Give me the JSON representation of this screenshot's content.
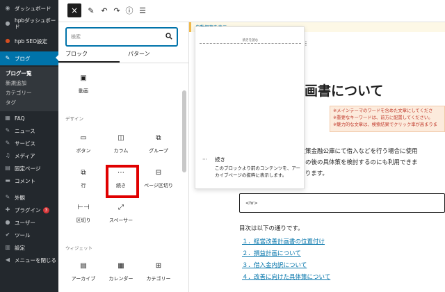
{
  "admin_menu": {
    "top_items": [
      {
        "icon": "dashboard-icon",
        "label": "ダッシュボード"
      },
      {
        "icon": "hpb-icon",
        "label": "hpbダッシュボード"
      },
      {
        "icon": "seo-icon",
        "label": "hpb SEO設定"
      }
    ],
    "active_item": {
      "icon": "blog-pin-icon",
      "label": "ブログ"
    },
    "submenu": [
      "ブログ一覧",
      "新規追加",
      "カテゴリー",
      "タグ"
    ],
    "items": [
      {
        "icon": "faq-icon",
        "label": "FAQ"
      },
      {
        "icon": "news-icon",
        "label": "ニュース"
      },
      {
        "icon": "service-icon",
        "label": "サービス"
      },
      {
        "icon": "media-icon",
        "label": "メディア"
      },
      {
        "icon": "page-icon",
        "label": "固定ページ"
      },
      {
        "icon": "comment-icon",
        "label": "コメント"
      },
      {
        "icon": "appearance-icon",
        "label": "外観"
      },
      {
        "icon": "plugin-icon",
        "label": "プラグイン",
        "badge": "3"
      },
      {
        "icon": "user-icon",
        "label": "ユーザー"
      },
      {
        "icon": "tool-icon",
        "label": "ツール"
      },
      {
        "icon": "settings-icon",
        "label": "設定"
      },
      {
        "icon": "collapse-icon",
        "label": "メニューを閉じる"
      }
    ]
  },
  "toolbar": {
    "close": "×",
    "tools": "✎",
    "undo": "↶",
    "redo": "↷",
    "info": "ⓘ",
    "outline": "☰"
  },
  "inserter": {
    "search_placeholder": "検索",
    "tabs": [
      "ブロック",
      "パターン"
    ],
    "media_block": {
      "icon": "video-icon",
      "label": "動画"
    },
    "design_heading": "デザイン",
    "design_blocks": [
      {
        "icon": "buttons-icon",
        "label": "ボタン"
      },
      {
        "icon": "columns-icon",
        "label": "カラム"
      },
      {
        "icon": "group-icon",
        "label": "グループ"
      },
      {
        "icon": "row-icon",
        "label": "行"
      },
      {
        "icon": "more-icon",
        "label": "続き"
      },
      {
        "icon": "page-break-icon",
        "label": "ページ区切り"
      },
      {
        "icon": "separator-icon",
        "label": "区切り"
      },
      {
        "icon": "spacer-icon",
        "label": "スペーサー"
      }
    ],
    "widgets_heading": "ウィジェット",
    "widget_blocks": [
      {
        "icon": "archive-icon",
        "label": "アーカイブ"
      },
      {
        "icon": "calendar-icon",
        "label": "カレンダー"
      },
      {
        "icon": "categories-icon",
        "label": "カテゴリー"
      }
    ]
  },
  "preview": {
    "inner_label": "続きを読む",
    "block_title": "続き",
    "description": "このブロックより前のコンテンツを、アーカイブページの抜粋に表示します。"
  },
  "editor": {
    "autosave_link": "自動保存を表示",
    "title": "画書について",
    "notes": [
      "※メインテーマのワードを含めた文章にしてくださ",
      "※重要なキーワードは、前方に配置してください。",
      "※魅力的な文章は、検索結果でクリック率が高まりま"
    ],
    "para1": [
      "本政策金融公庫にて借入などを行う場合に使用",
      "・その後の具体策を検討するのにも利用できま",
      "ております。"
    ],
    "hr_block": "<hr>",
    "toc_intro": "目次は以下の通りです。",
    "toc": [
      "１．経営改善計画書の位置付け",
      "２．損益計画について",
      "３．借入金内訳について",
      "４．改善に向けた具体策について"
    ]
  }
}
